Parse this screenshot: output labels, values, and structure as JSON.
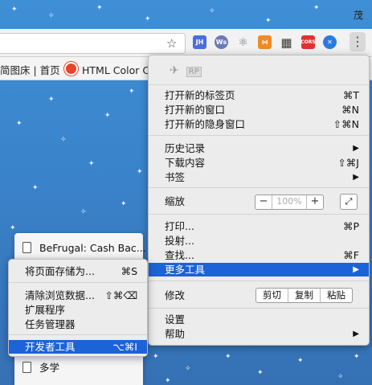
{
  "profile": {
    "name": "茂"
  },
  "extensions": [
    {
      "label": "JH",
      "color": "#4a6fd8"
    },
    {
      "label": "Ws",
      "color": "#6a7ab8"
    },
    {
      "label": "⚛",
      "color": "#6d7a8c"
    },
    {
      "label": "⋈",
      "color": "#f08a24"
    },
    {
      "label": "▦",
      "color": "#333333"
    },
    {
      "label": "CORS",
      "color": "#e03030"
    },
    {
      "label": "✕",
      "color": "#2a7be0"
    }
  ],
  "bookmarks": {
    "item1": "简图床 | 首页",
    "item2": "HTML Color Co"
  },
  "folder_panel": {
    "item_top": "BeFrugal: Cash Bac...",
    "item_bottom": "多学"
  },
  "main_menu": {
    "items": {
      "new_tab": {
        "label": "打开新的标签页",
        "shortcut": "⌘T"
      },
      "new_window": {
        "label": "打开新的窗口",
        "shortcut": "⌘N"
      },
      "incognito": {
        "label": "打开新的隐身窗口",
        "shortcut": "⇧⌘N"
      },
      "history": {
        "label": "历史记录"
      },
      "downloads": {
        "label": "下载内容",
        "shortcut": "⇧⌘J"
      },
      "bookmarks": {
        "label": "书签"
      },
      "zoom": {
        "label": "缩放",
        "minus": "−",
        "value": "100%",
        "plus": "+"
      },
      "print": {
        "label": "打印...",
        "shortcut": "⌘P"
      },
      "cast": {
        "label": "投射..."
      },
      "find": {
        "label": "查找...",
        "shortcut": "⌘F"
      },
      "more_tools": {
        "label": "更多工具"
      },
      "edit": {
        "label": "修改",
        "cut": "剪切",
        "copy": "复制",
        "paste": "粘贴"
      },
      "settings": {
        "label": "设置"
      },
      "help": {
        "label": "帮助"
      }
    }
  },
  "submenu": {
    "save_page": {
      "label": "将页面存储为...",
      "shortcut": "⌘S"
    },
    "clear_data": {
      "label": "清除浏览数据...",
      "shortcut": "⇧⌘⌫"
    },
    "extensions": {
      "label": "扩展程序"
    },
    "task_manager": {
      "label": "任务管理器"
    },
    "dev_tools": {
      "label": "开发者工具",
      "shortcut": "⌥⌘I"
    }
  }
}
